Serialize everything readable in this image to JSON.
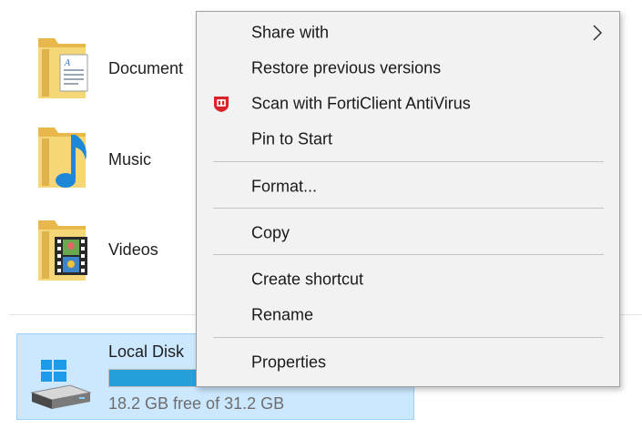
{
  "folders": [
    {
      "label": "Document",
      "icon": "documents-folder-icon"
    },
    {
      "label": "Music",
      "icon": "music-folder-icon"
    },
    {
      "label": "Videos",
      "icon": "videos-folder-icon"
    }
  ],
  "drive": {
    "name": "Local Disk",
    "free_text": "18.2 GB free of 31.2 GB",
    "used_fraction": 0.417,
    "icon": "windows-drive-icon"
  },
  "context_menu": {
    "items": [
      {
        "label": "Share with",
        "has_submenu": true
      },
      {
        "label": "Restore previous versions"
      },
      {
        "label": "Scan with FortiClient AntiVirus",
        "icon": "forticlient-shield-icon"
      },
      {
        "label": "Pin to Start"
      },
      {
        "label": "Format..."
      },
      {
        "label": "Copy"
      },
      {
        "label": "Create shortcut"
      },
      {
        "label": "Rename"
      },
      {
        "label": "Properties"
      }
    ]
  },
  "colors": {
    "selection_fill": "#cce8ff",
    "selection_border": "#99d1ff",
    "usage_bar": "#26a0da",
    "menu_background": "#f2f2f2",
    "forticlient_red": "#d8232a"
  }
}
